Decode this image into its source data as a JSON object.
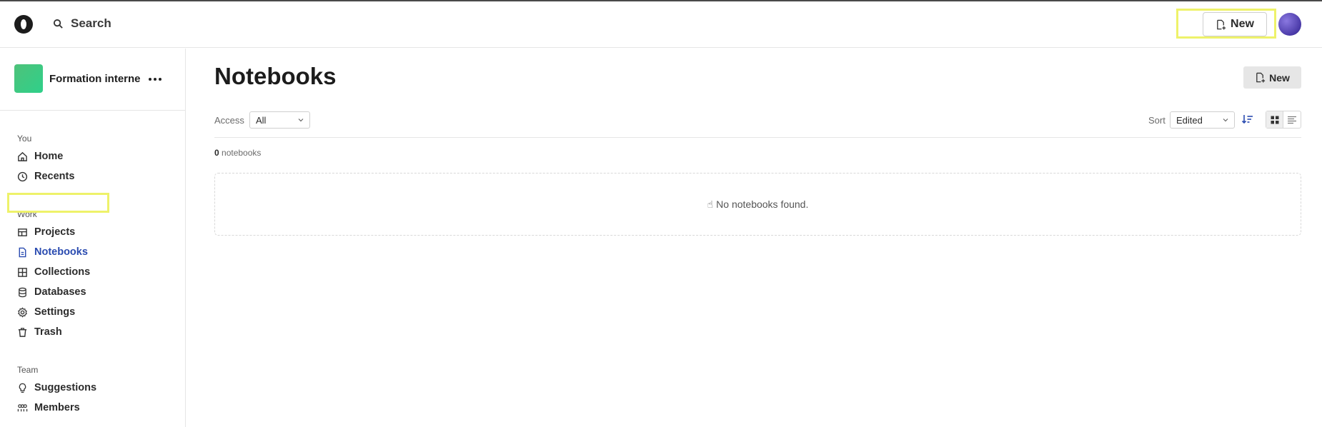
{
  "topbar": {
    "search_label": "Search",
    "new_label": "New"
  },
  "workspace": {
    "name": "Formation interne"
  },
  "sidebar": {
    "sections": [
      {
        "label": "You",
        "items": [
          {
            "label": "Home",
            "icon": "home-icon"
          },
          {
            "label": "Recents",
            "icon": "clock-icon"
          }
        ]
      },
      {
        "label": "Work",
        "items": [
          {
            "label": "Projects",
            "icon": "projects-icon"
          },
          {
            "label": "Notebooks",
            "icon": "notebook-icon",
            "active": true
          },
          {
            "label": "Collections",
            "icon": "collections-icon"
          },
          {
            "label": "Databases",
            "icon": "database-icon"
          },
          {
            "label": "Settings",
            "icon": "gear-icon"
          },
          {
            "label": "Trash",
            "icon": "trash-icon"
          }
        ]
      },
      {
        "label": "Team",
        "items": [
          {
            "label": "Suggestions",
            "icon": "lightbulb-icon"
          },
          {
            "label": "Members",
            "icon": "members-icon"
          }
        ]
      }
    ]
  },
  "main": {
    "title": "Notebooks",
    "new_label": "New",
    "access_label": "Access",
    "access_value": "All",
    "sort_label": "Sort",
    "sort_value": "Edited",
    "count_number": "0",
    "count_suffix": "notebooks",
    "empty_emoji": "☝",
    "empty_text": "No notebooks found."
  },
  "colors": {
    "accent": "#2a4bb0",
    "highlight": "#eef26a",
    "workspace_icon": "#3ec880"
  }
}
